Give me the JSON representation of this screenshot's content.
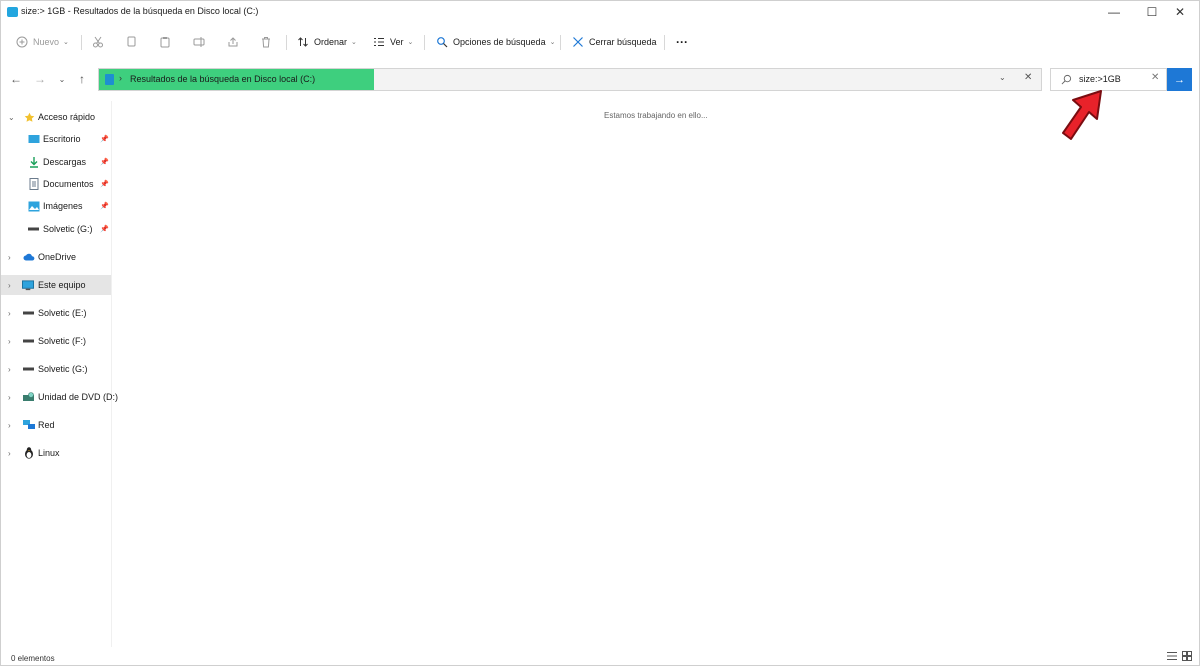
{
  "window": {
    "title": "size:> 1GB - Resultados de la búsqueda en Disco local (C:)",
    "controls": {
      "minimize": "—",
      "maximize": "☐",
      "close": "✕"
    }
  },
  "toolbar": {
    "new_label": "Nuevo",
    "sort_label": "Ordenar",
    "view_label": "Ver",
    "search_options_label": "Opciones de búsqueda",
    "close_search_label": "Cerrar búsqueda",
    "more_label": "···"
  },
  "address": {
    "separator": "›",
    "path": "Resultados de la búsqueda en Disco local (C:)"
  },
  "search": {
    "value": "size:>1GB",
    "clear": "✕",
    "go": "→"
  },
  "sidebar": {
    "quick_access": {
      "label": "Acceso rápido",
      "items": [
        {
          "label": "Escritorio"
        },
        {
          "label": "Descargas"
        },
        {
          "label": "Documentos"
        },
        {
          "label": "Imágenes"
        },
        {
          "label": "Solvetic (G:)"
        }
      ]
    },
    "roots": [
      {
        "label": "OneDrive"
      },
      {
        "label": "Este equipo"
      },
      {
        "label": "Solvetic (E:)"
      },
      {
        "label": "Solvetic (F:)"
      },
      {
        "label": "Solvetic (G:)"
      },
      {
        "label": "Unidad de DVD (D:)"
      },
      {
        "label": "Red"
      },
      {
        "label": "Linux"
      }
    ]
  },
  "content": {
    "status_message": "Estamos trabajando en ello..."
  },
  "statusbar": {
    "count": "0 elementos"
  },
  "colors": {
    "highlight": "#3ecf7e",
    "accent": "#1e78d6",
    "pointer": "#e8222a"
  }
}
